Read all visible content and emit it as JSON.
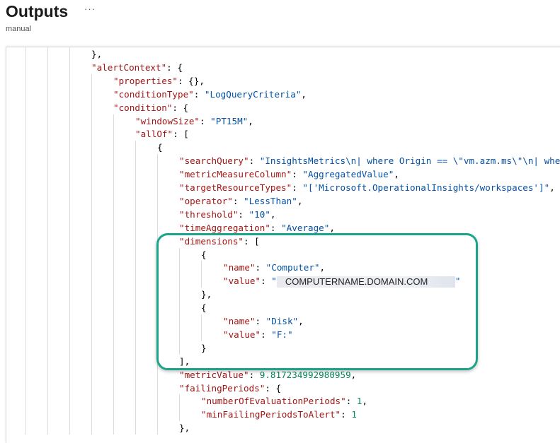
{
  "header": {
    "title": "Outputs",
    "more_label": "···",
    "subtitle": "manual"
  },
  "colors": {
    "key": "#a31515",
    "string": "#0451a5",
    "number": "#098658",
    "highlight": "#1aa58a"
  },
  "code_lines": [
    {
      "indent": 0,
      "tokens": [
        [
          "p",
          "},"
        ]
      ]
    },
    {
      "indent": 0,
      "tokens": [
        [
          "k",
          "\"alertContext\""
        ],
        [
          "p",
          ": {"
        ]
      ]
    },
    {
      "indent": 1,
      "tokens": [
        [
          "k",
          "\"properties\""
        ],
        [
          "p",
          ": {},"
        ]
      ]
    },
    {
      "indent": 1,
      "tokens": [
        [
          "k",
          "\"conditionType\""
        ],
        [
          "p",
          ": "
        ],
        [
          "s",
          "\"LogQueryCriteria\""
        ],
        [
          "p",
          ","
        ]
      ]
    },
    {
      "indent": 1,
      "tokens": [
        [
          "k",
          "\"condition\""
        ],
        [
          "p",
          ": {"
        ]
      ]
    },
    {
      "indent": 2,
      "tokens": [
        [
          "k",
          "\"windowSize\""
        ],
        [
          "p",
          ": "
        ],
        [
          "s",
          "\"PT15M\""
        ],
        [
          "p",
          ","
        ]
      ]
    },
    {
      "indent": 2,
      "tokens": [
        [
          "k",
          "\"allOf\""
        ],
        [
          "p",
          ": ["
        ]
      ]
    },
    {
      "indent": 3,
      "tokens": [
        [
          "p",
          "{"
        ]
      ]
    },
    {
      "indent": 4,
      "tokens": [
        [
          "k",
          "\"searchQuery\""
        ],
        [
          "p",
          ": "
        ],
        [
          "s",
          "\"InsightsMetrics\\n| where Origin == \\\"vm.azm.ms\\\"\\n| whe"
        ]
      ]
    },
    {
      "indent": 4,
      "tokens": [
        [
          "k",
          "\"metricMeasureColumn\""
        ],
        [
          "p",
          ": "
        ],
        [
          "s",
          "\"AggregatedValue\""
        ],
        [
          "p",
          ","
        ]
      ]
    },
    {
      "indent": 4,
      "tokens": [
        [
          "k",
          "\"targetResourceTypes\""
        ],
        [
          "p",
          ": "
        ],
        [
          "s",
          "\"['Microsoft.OperationalInsights/workspaces']\""
        ],
        [
          "p",
          ","
        ]
      ]
    },
    {
      "indent": 4,
      "tokens": [
        [
          "k",
          "\"operator\""
        ],
        [
          "p",
          ": "
        ],
        [
          "s",
          "\"LessThan\""
        ],
        [
          "p",
          ","
        ]
      ]
    },
    {
      "indent": 4,
      "tokens": [
        [
          "k",
          "\"threshold\""
        ],
        [
          "p",
          ": "
        ],
        [
          "s",
          "\"10\""
        ],
        [
          "p",
          ","
        ]
      ]
    },
    {
      "indent": 4,
      "tokens": [
        [
          "k",
          "\"timeAggregation\""
        ],
        [
          "p",
          ": "
        ],
        [
          "s",
          "\"Average\""
        ],
        [
          "p",
          ","
        ]
      ]
    },
    {
      "indent": 4,
      "tokens": [
        [
          "k",
          "\"dimensions\""
        ],
        [
          "p",
          ": ["
        ]
      ]
    },
    {
      "indent": 5,
      "tokens": [
        [
          "p",
          "{"
        ]
      ]
    },
    {
      "indent": 6,
      "tokens": [
        [
          "k",
          "\"name\""
        ],
        [
          "p",
          ": "
        ],
        [
          "s",
          "\"Computer\""
        ],
        [
          "p",
          ","
        ]
      ]
    },
    {
      "indent": 6,
      "tokens": [
        [
          "k",
          "\"value\""
        ],
        [
          "p",
          ": "
        ],
        [
          "s",
          "\""
        ],
        [
          "r",
          "COMPUTERNAME.DOMAIN.COM"
        ],
        [
          "s",
          "\""
        ]
      ]
    },
    {
      "indent": 5,
      "tokens": [
        [
          "p",
          "},"
        ]
      ]
    },
    {
      "indent": 5,
      "tokens": [
        [
          "p",
          "{"
        ]
      ]
    },
    {
      "indent": 6,
      "tokens": [
        [
          "k",
          "\"name\""
        ],
        [
          "p",
          ": "
        ],
        [
          "s",
          "\"Disk\""
        ],
        [
          "p",
          ","
        ]
      ]
    },
    {
      "indent": 6,
      "tokens": [
        [
          "k",
          "\"value\""
        ],
        [
          "p",
          ": "
        ],
        [
          "s",
          "\"F:\""
        ]
      ]
    },
    {
      "indent": 5,
      "tokens": [
        [
          "p",
          "}"
        ]
      ]
    },
    {
      "indent": 4,
      "tokens": [
        [
          "p",
          "],"
        ]
      ]
    },
    {
      "indent": 4,
      "tokens": [
        [
          "k",
          "\"metricValue\""
        ],
        [
          "p",
          ": "
        ],
        [
          "n",
          "9.817234992980959"
        ],
        [
          "p",
          ","
        ]
      ]
    },
    {
      "indent": 4,
      "tokens": [
        [
          "k",
          "\"failingPeriods\""
        ],
        [
          "p",
          ": {"
        ]
      ]
    },
    {
      "indent": 5,
      "tokens": [
        [
          "k",
          "\"numberOfEvaluationPeriods\""
        ],
        [
          "p",
          ": "
        ],
        [
          "n",
          "1"
        ],
        [
          "p",
          ","
        ]
      ]
    },
    {
      "indent": 5,
      "tokens": [
        [
          "k",
          "\"minFailingPeriodsToAlert\""
        ],
        [
          "p",
          ": "
        ],
        [
          "n",
          "1"
        ]
      ]
    },
    {
      "indent": 4,
      "tokens": [
        [
          "p",
          "},"
        ]
      ]
    }
  ]
}
